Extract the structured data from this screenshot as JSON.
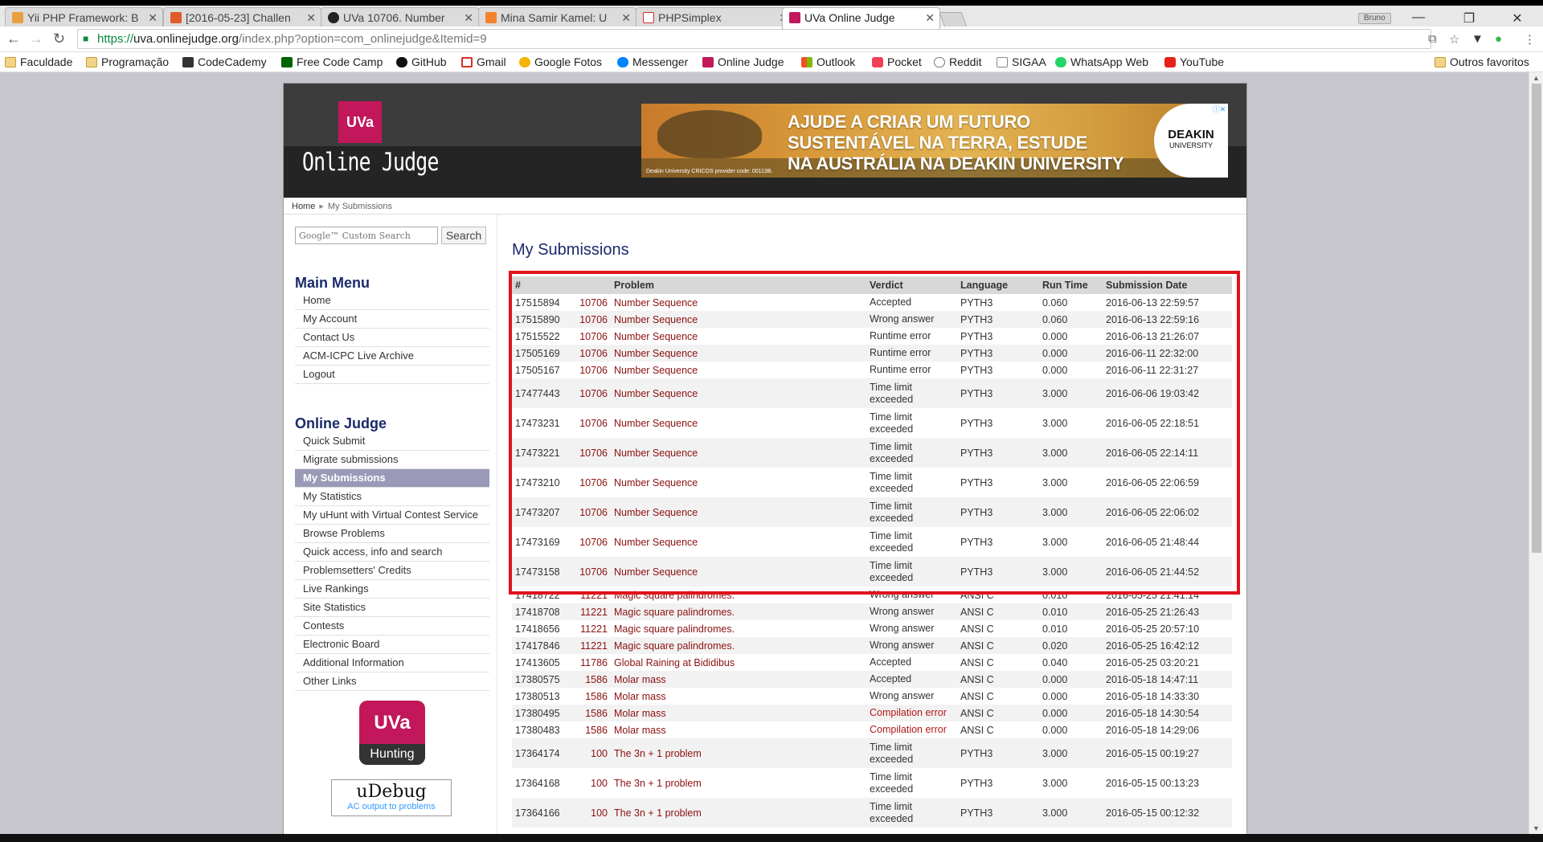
{
  "browser": {
    "tabs": [
      {
        "label": "Yii PHP Framework: B",
        "color": "#e8a040"
      },
      {
        "label": "[2016-05-23] Challen",
        "color": "#e05a2a"
      },
      {
        "label": "UVa 10706. Number",
        "color": "#222222"
      },
      {
        "label": "Mina Samir Kamel: U",
        "color": "#f4822a"
      },
      {
        "label": "PHPSimplex",
        "color": "#d23030"
      },
      {
        "label": "UVa Online Judge",
        "color": "#c2185b"
      }
    ],
    "profile": "Bruno",
    "url_scheme": "https://",
    "url_host": "uva.onlinejudge.org",
    "url_path": "/index.php?option=com_onlinejudge&Itemid=9",
    "bookmarks": [
      {
        "label": "Faculdade",
        "icon": "folder-icon"
      },
      {
        "label": "Programação",
        "icon": "folder-icon"
      },
      {
        "label": "CodeCademy",
        "icon": "codecademy-icon"
      },
      {
        "label": "Free Code Camp",
        "icon": "freecodecamp-icon"
      },
      {
        "label": "GitHub",
        "icon": "github-icon"
      },
      {
        "label": "Gmail",
        "icon": "gmail-icon"
      },
      {
        "label": "Google Fotos",
        "icon": "google-photos-icon"
      },
      {
        "label": "Messenger",
        "icon": "messenger-icon"
      },
      {
        "label": "Online Judge",
        "icon": "uva-icon"
      },
      {
        "label": "Outlook",
        "icon": "outlook-icon"
      },
      {
        "label": "Pocket",
        "icon": "pocket-icon"
      },
      {
        "label": "Reddit",
        "icon": "reddit-icon"
      },
      {
        "label": "SIGAA",
        "icon": "page-icon"
      },
      {
        "label": "WhatsApp Web",
        "icon": "whatsapp-icon"
      },
      {
        "label": "YouTube",
        "icon": "youtube-icon"
      }
    ],
    "other_bookmarks": "Outros favoritos"
  },
  "site": {
    "logo": "UVa",
    "name": "Online Judge",
    "ad": {
      "line1": "AJUDE A CRIAR UM FUTURO",
      "line2": "SUSTENTÁVEL NA TERRA, ESTUDE",
      "line3": "NA AUSTRÁLIA NA DEAKIN UNIVERSITY",
      "brand": "DEAKIN",
      "brand_sub": "UNIVERSITY",
      "fine_print": "Deakin University CRICOS provider code: 00113B."
    },
    "breadcrumb": {
      "home": "Home",
      "current": "My Submissions"
    }
  },
  "sidebar": {
    "search_placeholder": "Google™ Custom Search",
    "search_button": "Search",
    "main_menu_title": "Main Menu",
    "main_menu": [
      "Home",
      "My Account",
      "Contact Us",
      "ACM-ICPC Live Archive",
      "Logout"
    ],
    "judge_title": "Online Judge",
    "judge_menu": [
      "Quick Submit",
      "Migrate submissions",
      "My Submissions",
      "My Statistics",
      "My uHunt with Virtual Contest Service",
      "Browse Problems",
      "Quick access, info and search",
      "Problemsetters' Credits",
      "Live Rankings",
      "Site Statistics",
      "Contests",
      "Electronic Board",
      "Additional Information",
      "Other Links"
    ],
    "selected": "My Submissions",
    "uhunt_top": "UVa",
    "uhunt_bottom": "Hunting",
    "udebug_title": "uDebug",
    "udebug_sub": "AC output to problems"
  },
  "main": {
    "title": "My Submissions",
    "columns": [
      "#",
      "Problem",
      "Verdict",
      "Language",
      "Run Time",
      "Submission Date"
    ],
    "rows": [
      {
        "id": "17515894",
        "pnum": "10706",
        "pname": "Number Sequence",
        "verdict": "Accepted",
        "lang": "PYTH3",
        "time": "0.060",
        "date": "2016-06-13 22:59:57"
      },
      {
        "id": "17515890",
        "pnum": "10706",
        "pname": "Number Sequence",
        "verdict": "Wrong answer",
        "lang": "PYTH3",
        "time": "0.060",
        "date": "2016-06-13 22:59:16"
      },
      {
        "id": "17515522",
        "pnum": "10706",
        "pname": "Number Sequence",
        "verdict": "Runtime error",
        "lang": "PYTH3",
        "time": "0.000",
        "date": "2016-06-13 21:26:07"
      },
      {
        "id": "17505169",
        "pnum": "10706",
        "pname": "Number Sequence",
        "verdict": "Runtime error",
        "lang": "PYTH3",
        "time": "0.000",
        "date": "2016-06-11 22:32:00"
      },
      {
        "id": "17505167",
        "pnum": "10706",
        "pname": "Number Sequence",
        "verdict": "Runtime error",
        "lang": "PYTH3",
        "time": "0.000",
        "date": "2016-06-11 22:31:27"
      },
      {
        "id": "17477443",
        "pnum": "10706",
        "pname": "Number Sequence",
        "verdict": "Time limit exceeded",
        "lang": "PYTH3",
        "time": "3.000",
        "date": "2016-06-06 19:03:42"
      },
      {
        "id": "17473231",
        "pnum": "10706",
        "pname": "Number Sequence",
        "verdict": "Time limit exceeded",
        "lang": "PYTH3",
        "time": "3.000",
        "date": "2016-06-05 22:18:51"
      },
      {
        "id": "17473221",
        "pnum": "10706",
        "pname": "Number Sequence",
        "verdict": "Time limit exceeded",
        "lang": "PYTH3",
        "time": "3.000",
        "date": "2016-06-05 22:14:11"
      },
      {
        "id": "17473210",
        "pnum": "10706",
        "pname": "Number Sequence",
        "verdict": "Time limit exceeded",
        "lang": "PYTH3",
        "time": "3.000",
        "date": "2016-06-05 22:06:59"
      },
      {
        "id": "17473207",
        "pnum": "10706",
        "pname": "Number Sequence",
        "verdict": "Time limit exceeded",
        "lang": "PYTH3",
        "time": "3.000",
        "date": "2016-06-05 22:06:02"
      },
      {
        "id": "17473169",
        "pnum": "10706",
        "pname": "Number Sequence",
        "verdict": "Time limit exceeded",
        "lang": "PYTH3",
        "time": "3.000",
        "date": "2016-06-05 21:48:44"
      },
      {
        "id": "17473158",
        "pnum": "10706",
        "pname": "Number Sequence",
        "verdict": "Time limit exceeded",
        "lang": "PYTH3",
        "time": "3.000",
        "date": "2016-06-05 21:44:52"
      },
      {
        "id": "17418722",
        "pnum": "11221",
        "pname": "Magic square palindromes.",
        "verdict": "Wrong answer",
        "lang": "ANSI C",
        "time": "0.010",
        "date": "2016-05-25 21:41:14"
      },
      {
        "id": "17418708",
        "pnum": "11221",
        "pname": "Magic square palindromes.",
        "verdict": "Wrong answer",
        "lang": "ANSI C",
        "time": "0.010",
        "date": "2016-05-25 21:26:43"
      },
      {
        "id": "17418656",
        "pnum": "11221",
        "pname": "Magic square palindromes.",
        "verdict": "Wrong answer",
        "lang": "ANSI C",
        "time": "0.010",
        "date": "2016-05-25 20:57:10"
      },
      {
        "id": "17417846",
        "pnum": "11221",
        "pname": "Magic square palindromes.",
        "verdict": "Wrong answer",
        "lang": "ANSI C",
        "time": "0.020",
        "date": "2016-05-25 16:42:12"
      },
      {
        "id": "17413605",
        "pnum": "11786",
        "pname": "Global Raining at Bididibus",
        "verdict": "Accepted",
        "lang": "ANSI C",
        "time": "0.040",
        "date": "2016-05-25 03:20:21"
      },
      {
        "id": "17380575",
        "pnum": "1586",
        "pname": "Molar mass",
        "verdict": "Accepted",
        "lang": "ANSI C",
        "time": "0.000",
        "date": "2016-05-18 14:47:11"
      },
      {
        "id": "17380513",
        "pnum": "1586",
        "pname": "Molar mass",
        "verdict": "Wrong answer",
        "lang": "ANSI C",
        "time": "0.000",
        "date": "2016-05-18 14:33:30"
      },
      {
        "id": "17380495",
        "pnum": "1586",
        "pname": "Molar mass",
        "verdict": "Compilation error",
        "lang": "ANSI C",
        "time": "0.000",
        "date": "2016-05-18 14:30:54"
      },
      {
        "id": "17380483",
        "pnum": "1586",
        "pname": "Molar mass",
        "verdict": "Compilation error",
        "lang": "ANSI C",
        "time": "0.000",
        "date": "2016-05-18 14:29:06"
      },
      {
        "id": "17364174",
        "pnum": "100",
        "pname": "The 3n + 1 problem",
        "verdict": "Time limit exceeded",
        "lang": "PYTH3",
        "time": "3.000",
        "date": "2016-05-15 00:19:27"
      },
      {
        "id": "17364168",
        "pnum": "100",
        "pname": "The 3n + 1 problem",
        "verdict": "Time limit exceeded",
        "lang": "PYTH3",
        "time": "3.000",
        "date": "2016-05-15 00:13:23"
      },
      {
        "id": "17364166",
        "pnum": "100",
        "pname": "The 3n + 1 problem",
        "verdict": "Time limit exceeded",
        "lang": "PYTH3",
        "time": "3.000",
        "date": "2016-05-15 00:12:32"
      }
    ]
  }
}
